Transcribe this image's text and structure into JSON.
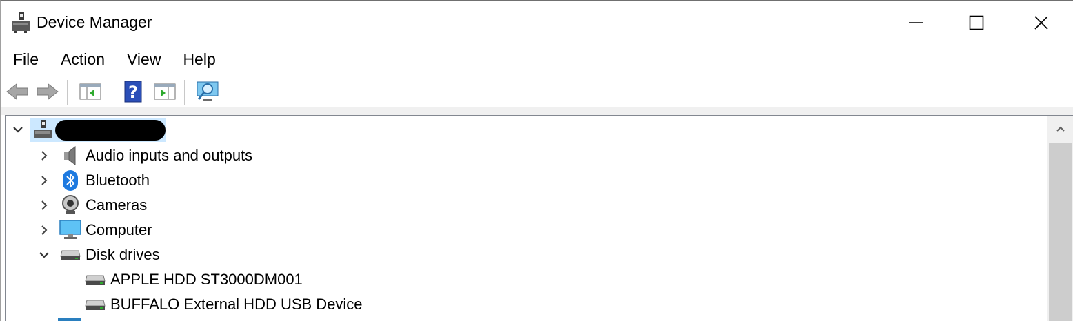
{
  "window": {
    "title": "Device Manager",
    "controls": {
      "minimize": "minimize",
      "maximize": "maximize",
      "close": "close"
    }
  },
  "menu": {
    "items": [
      {
        "label": "File"
      },
      {
        "label": "Action"
      },
      {
        "label": "View"
      },
      {
        "label": "Help"
      }
    ]
  },
  "toolbar": {
    "buttons": [
      "back-icon",
      "forward-icon",
      "show-hide-console-tree-icon",
      "help-icon",
      "properties-pane-icon",
      "scan-hardware-icon"
    ]
  },
  "tree": {
    "root": {
      "label": "",
      "expanded": true,
      "selected": true
    },
    "categories": [
      {
        "label": "Audio inputs and outputs",
        "icon": "speaker-icon",
        "expanded": false
      },
      {
        "label": "Bluetooth",
        "icon": "bluetooth-icon",
        "expanded": false
      },
      {
        "label": "Cameras",
        "icon": "webcam-icon",
        "expanded": false
      },
      {
        "label": "Computer",
        "icon": "monitor-icon",
        "expanded": false
      },
      {
        "label": "Disk drives",
        "icon": "disk-drive-icon",
        "expanded": true,
        "children": [
          {
            "label": "APPLE HDD ST3000DM001",
            "icon": "disk-drive-icon"
          },
          {
            "label": "BUFFALO External HDD USB Device",
            "icon": "disk-drive-icon"
          }
        ]
      }
    ]
  },
  "colors": {
    "selection": "#cce8ff",
    "bluetooth": "#1e7ae0",
    "accent_green": "#2eaa2e"
  }
}
